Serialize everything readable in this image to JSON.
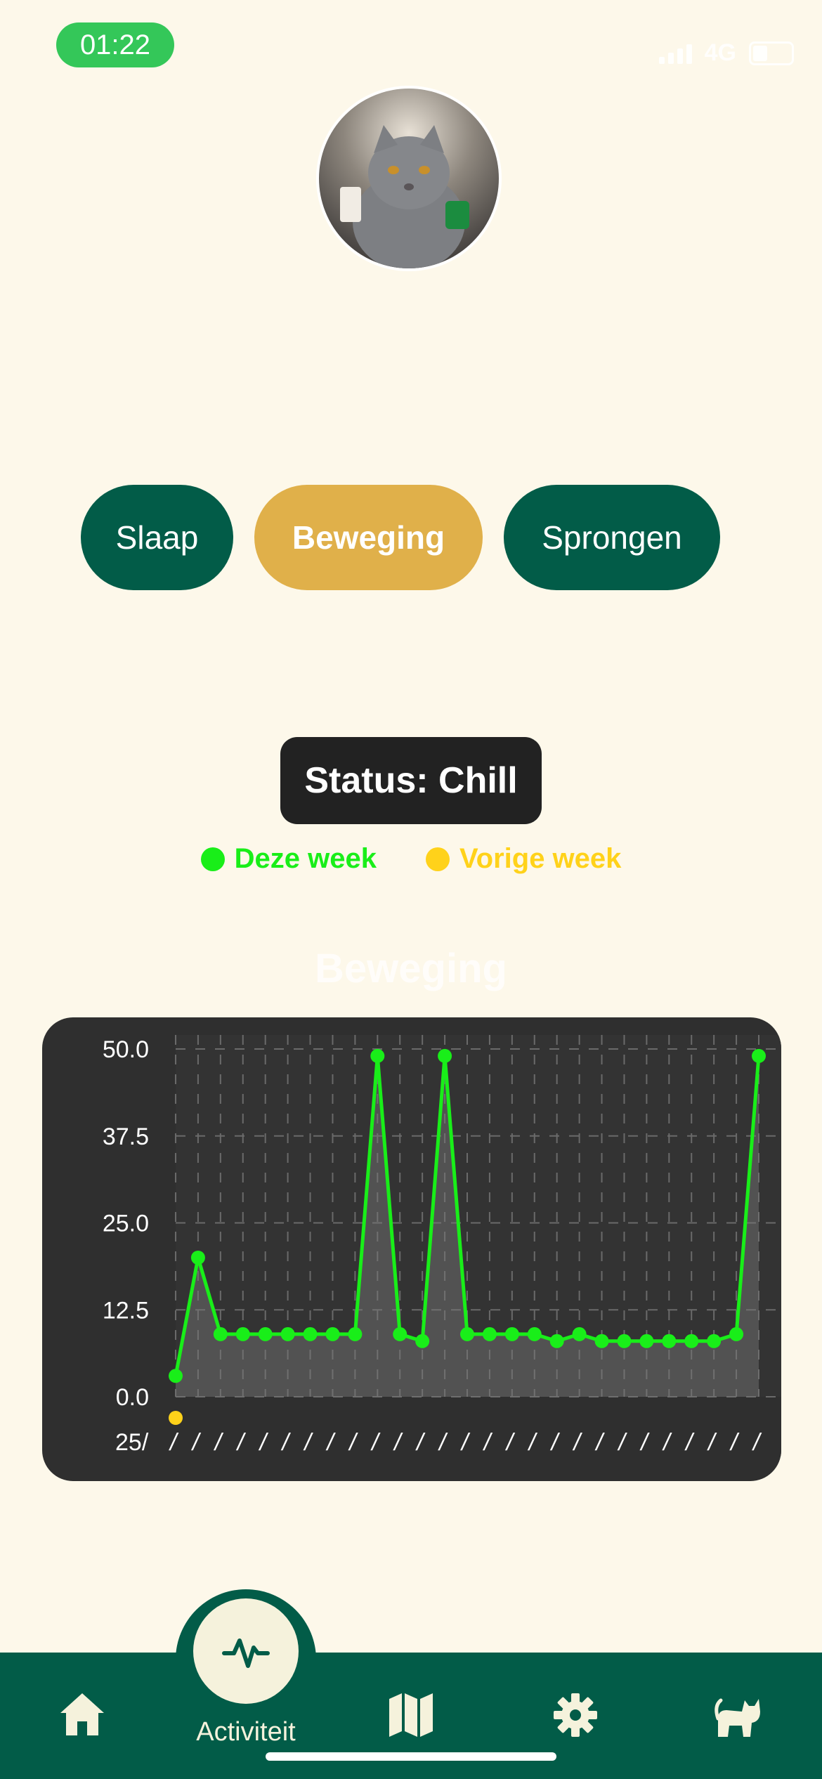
{
  "status_bar": {
    "time": "01:22",
    "network": "4G"
  },
  "tabs": [
    {
      "label": "Slaap",
      "active": false
    },
    {
      "label": "Beweging",
      "active": true
    },
    {
      "label": "Sprongen",
      "active": false
    }
  ],
  "status": {
    "text": "Status: Chill"
  },
  "legend": [
    {
      "label": "Deze week",
      "color": "#19ee19"
    },
    {
      "label": "Vorige week",
      "color": "#ffd21a"
    }
  ],
  "chart_data": {
    "type": "line",
    "title": "Beweging",
    "ylim": [
      0,
      50
    ],
    "yticks": [
      "50.0",
      "37.5",
      "25.0",
      "12.5",
      "0.0"
    ],
    "xtick_first": "25/",
    "grid": true,
    "series": [
      {
        "name": "Deze week",
        "color": "#19ee19",
        "values": [
          3,
          20,
          9,
          9,
          9,
          9,
          9,
          9,
          9,
          49,
          9,
          8,
          49,
          9,
          9,
          9,
          9,
          8,
          9,
          8,
          8,
          8,
          8,
          8,
          8,
          9,
          49
        ]
      },
      {
        "name": "Vorige week",
        "color": "#ffd21a",
        "values": [
          0
        ]
      }
    ]
  },
  "nav": {
    "items": [
      {
        "icon": "home-icon"
      },
      {
        "icon": "activity-icon",
        "label": "Activiteit",
        "active": true
      },
      {
        "icon": "map-icon"
      },
      {
        "icon": "gear-icon"
      },
      {
        "icon": "cat-icon"
      }
    ]
  }
}
